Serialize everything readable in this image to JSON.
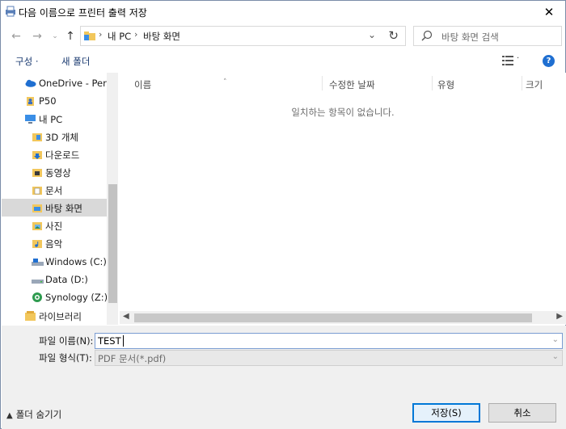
{
  "window": {
    "title": "다음 이름으로 프린터 출력 저장"
  },
  "navigation": {
    "breadcrumbs": [
      "내 PC",
      "바탕 화면"
    ],
    "search_placeholder": "바탕 화면 검색"
  },
  "toolbar": {
    "organize_label": "구성 ·",
    "new_folder_label": "새 폴더"
  },
  "tree": {
    "items": [
      {
        "label": "OneDrive - Perso",
        "icon": "cloud-icon"
      },
      {
        "label": "P50",
        "icon": "user-folder-icon"
      },
      {
        "label": "내 PC",
        "icon": "computer-icon"
      },
      {
        "label": "3D 개체",
        "icon": "3d-objects-icon"
      },
      {
        "label": "다운로드",
        "icon": "downloads-icon"
      },
      {
        "label": "동영상",
        "icon": "videos-icon"
      },
      {
        "label": "문서",
        "icon": "documents-icon"
      },
      {
        "label": "바탕 화면",
        "icon": "desktop-icon",
        "selected": true
      },
      {
        "label": "사진",
        "icon": "pictures-icon"
      },
      {
        "label": "음악",
        "icon": "music-icon"
      },
      {
        "label": "Windows (C:)",
        "icon": "drive-icon"
      },
      {
        "label": "Data (D:)",
        "icon": "drive-icon"
      },
      {
        "label": "Synology (Z:)",
        "icon": "network-drive-icon"
      },
      {
        "label": "라이브러리",
        "icon": "library-icon"
      }
    ]
  },
  "list": {
    "columns": [
      "이름",
      "수정한 날짜",
      "유형",
      "크기"
    ],
    "empty_message": "일치하는 항목이 없습니다."
  },
  "form": {
    "filename_label": "파일 이름(N):",
    "filename_value": "TEST",
    "filetype_label": "파일 형식(T):",
    "filetype_value": "PDF 문서(*.pdf)"
  },
  "footer": {
    "hide_folders_label": "폴더 숨기기",
    "save_label": "저장(S)",
    "cancel_label": "취소"
  },
  "colors": {
    "accent": "#0078d7",
    "help": "#1f6fd1",
    "folder": "#f2c75c"
  }
}
